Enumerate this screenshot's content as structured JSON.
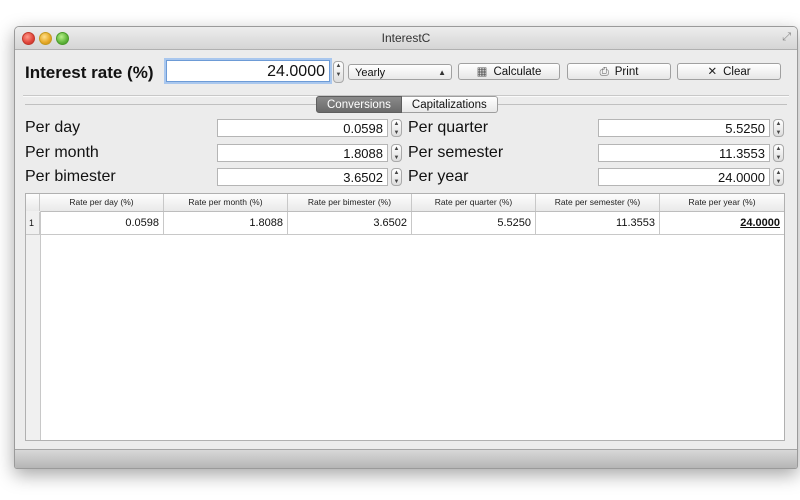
{
  "window": {
    "title": "InterestC"
  },
  "toolbar": {
    "rate_label": "Interest rate (%)",
    "rate_value": "24.0000",
    "period_select": "Yearly",
    "calculate_label": "Calculate",
    "print_label": "Print",
    "clear_label": "Clear"
  },
  "tabs": [
    {
      "label": "Conversions",
      "active": true
    },
    {
      "label": "Capitalizations",
      "active": false
    }
  ],
  "fields": {
    "per_day": {
      "label": "Per day",
      "value": "0.0598"
    },
    "per_month": {
      "label": "Per month",
      "value": "1.8088"
    },
    "per_bimester": {
      "label": "Per bimester",
      "value": "3.6502"
    },
    "per_quarter": {
      "label": "Per quarter",
      "value": "5.5250"
    },
    "per_semester": {
      "label": "Per semester",
      "value": "11.3553"
    },
    "per_year": {
      "label": "Per year",
      "value": "24.0000"
    }
  },
  "table": {
    "columns": [
      "Rate per day (%)",
      "Rate per month (%)",
      "Rate per bimester (%)",
      "Rate per quarter (%)",
      "Rate per semester (%)",
      "Rate per year (%)"
    ],
    "rows": [
      {
        "index": "1",
        "cells": [
          "0.0598",
          "1.8088",
          "3.6502",
          "5.5250",
          "11.3553",
          "24.0000"
        ]
      }
    ]
  },
  "colors": {
    "focus_ring": "#6d9bd6",
    "active_tab": "#707070"
  }
}
